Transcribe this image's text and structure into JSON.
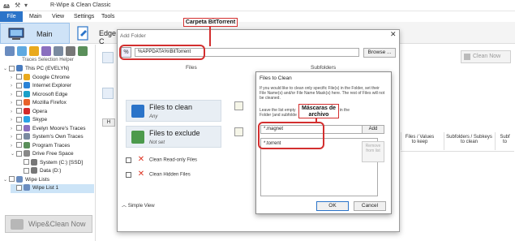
{
  "window": {
    "title": "R-Wipe & Clean Classic"
  },
  "menu": {
    "file": "File",
    "items": [
      "Main",
      "View",
      "Settings",
      "Tools"
    ]
  },
  "ribbon": {
    "main_label": "Main",
    "edge_label": "Edge C"
  },
  "sidebar": {
    "helper_label": "Traces Selection Helper",
    "tree": [
      {
        "label": "This PC  (EVELYN)",
        "level": 0,
        "exp": "v",
        "checked": false,
        "icon_color": "#4a7cbf"
      },
      {
        "label": "Google Chrome",
        "level": 1,
        "exp": ">",
        "checked": false,
        "icon_color": "#e9a91d"
      },
      {
        "label": "Internet  Explorer",
        "level": 1,
        "exp": ">",
        "checked": false,
        "icon_color": "#2a82d6"
      },
      {
        "label": "Microsoft Edge",
        "level": 1,
        "exp": ">",
        "checked": false,
        "icon_color": "#1aa0c8"
      },
      {
        "label": "Mozilla Firefox",
        "level": 1,
        "exp": ">",
        "checked": false,
        "icon_color": "#e8622a"
      },
      {
        "label": "Opera",
        "level": 1,
        "exp": ">",
        "checked": false,
        "icon_color": "#d42b2b"
      },
      {
        "label": "Skype",
        "level": 1,
        "exp": ">",
        "checked": false,
        "icon_color": "#2aa3e6"
      },
      {
        "label": "Evelyn Moore's Traces",
        "level": 1,
        "exp": ">",
        "checked": false,
        "icon_color": "#8a6fbf"
      },
      {
        "label": "System's Own Traces",
        "level": 1,
        "exp": ">",
        "checked": false,
        "icon_color": "#7a8aa0"
      },
      {
        "label": "Program Traces",
        "level": 1,
        "exp": ">",
        "checked": false,
        "icon_color": "#5a8f5a"
      },
      {
        "label": "Drive Free Space",
        "level": 1,
        "exp": "v",
        "checked": false,
        "icon_color": "#888888"
      },
      {
        "label": "System  (C:) [SSD]",
        "level": 2,
        "exp": "",
        "checked": false,
        "icon_color": "#777777"
      },
      {
        "label": "Data  (D:)",
        "level": 2,
        "exp": "",
        "checked": false,
        "icon_color": "#777777"
      },
      {
        "label": "Wipe Lists",
        "level": 0,
        "exp": "v",
        "checked": false,
        "icon_color": "#6a8cbf"
      },
      {
        "label": "Wipe List 1",
        "level": 1,
        "exp": "",
        "checked": false,
        "icon_color": "#6a8cbf",
        "selected": true
      }
    ],
    "wipe_now": "Wipe&Clean Now"
  },
  "main": {
    "clean_now": "Clean Now",
    "columns": [
      "Files / Values\nto keep",
      "Subfolders / Subkeys\nto clean",
      "Subf\nto"
    ]
  },
  "add_folder": {
    "title": "Add Folder",
    "path_value": "%APPDATA%\\BitTorrent",
    "browse": "Browse ...",
    "files_header": "Files",
    "subfolders_header": "Subfolders",
    "files_to_clean": {
      "title": "Files to clean",
      "sub": "Any"
    },
    "files_to_exclude": {
      "title": "Files to exclude",
      "sub": "Not set"
    },
    "clean_readonly": "Clean Read-only Files",
    "clean_hidden": "Clean Hidden Files",
    "simple_view": "Simple View"
  },
  "files_to_clean": {
    "title": "Files to Clean",
    "desc": "If you would like to clean only specific File(s) in the Folder, set their File Name(s) and/or File Name Mask(s) here. The rest of Files will not be cleaned.",
    "desc2_a": "Leave the list empty",
    "desc2_b": "iles in the",
    "desc2_c": "Folder (and subfolde",
    "mask_input": "*.magnet",
    "add": "Add",
    "list_items": [
      "*.torrent"
    ],
    "remove": "Remove from list",
    "ok": "OK",
    "cancel": "Cancel"
  },
  "annotations": {
    "folder": "Carpeta BitTorrent",
    "masks": "Máscaras de archivo"
  }
}
